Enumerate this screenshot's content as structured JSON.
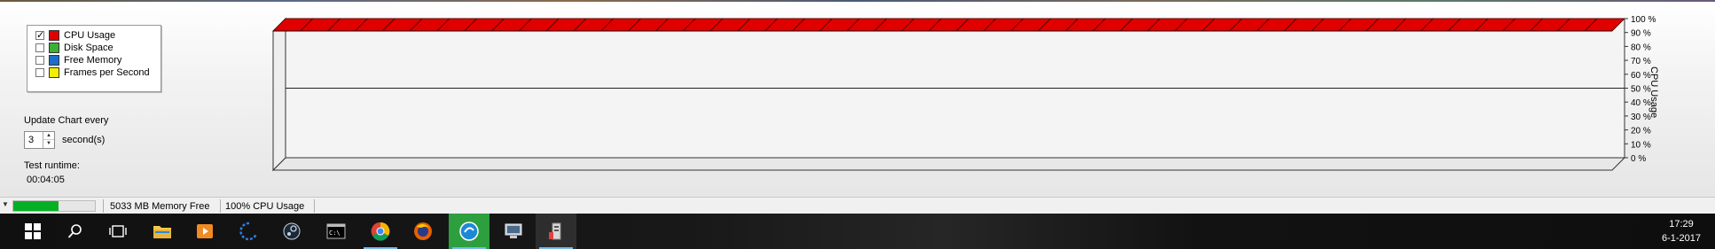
{
  "legend": {
    "items": [
      {
        "label": "CPU Usage",
        "checked": true,
        "color": "#e00000"
      },
      {
        "label": "Disk Space",
        "checked": false,
        "color": "#3cb034"
      },
      {
        "label": "Free Memory",
        "checked": false,
        "color": "#1a6ec8"
      },
      {
        "label": "Frames per Second",
        "checked": false,
        "color": "#f0f000"
      }
    ]
  },
  "controls": {
    "update_label": "Update Chart every",
    "interval_value": "3",
    "interval_unit": "second(s)",
    "runtime_label": "Test runtime:",
    "runtime_value": "00:04:05"
  },
  "chart_data": {
    "type": "area",
    "series": [
      {
        "name": "CPU Usage",
        "values": [
          100,
          100,
          100,
          100,
          100,
          100,
          100,
          100,
          100,
          100,
          100,
          100,
          100,
          100,
          100,
          100,
          100,
          100,
          100,
          100,
          100,
          100,
          100,
          100,
          100,
          100,
          100,
          100,
          100,
          100,
          100,
          100,
          100,
          100,
          100,
          100,
          100,
          100,
          100,
          100,
          100,
          100,
          100,
          100,
          100,
          100,
          100,
          100,
          100,
          100
        ],
        "color": "#e00000"
      }
    ],
    "ylabel": "CPU Usage",
    "yticks": [
      "100 %",
      "90 %",
      "80 %",
      "70 %",
      "60 %",
      "50 %",
      "40 %",
      "30 %",
      "20 %",
      "10 %",
      "0 %"
    ],
    "ylim": [
      0,
      100
    ],
    "grid": "midline at 50 %",
    "style": "3D"
  },
  "statusbar": {
    "progress": 0.55,
    "memory_text": "5033 MB Memory Free",
    "cpu_text": "100% CPU Usage"
  },
  "taskbar": {
    "apps": [
      "start-icon",
      "search-icon",
      "task-view-icon",
      "file-explorer-icon",
      "media-player-icon",
      "edge-icon",
      "steam-icon",
      "terminal-icon",
      "chrome-icon",
      "firefox-icon",
      "app-circle-icon",
      "network-icon",
      "benchmark-icon"
    ],
    "time": "17:29",
    "date": "6-1-2017"
  }
}
